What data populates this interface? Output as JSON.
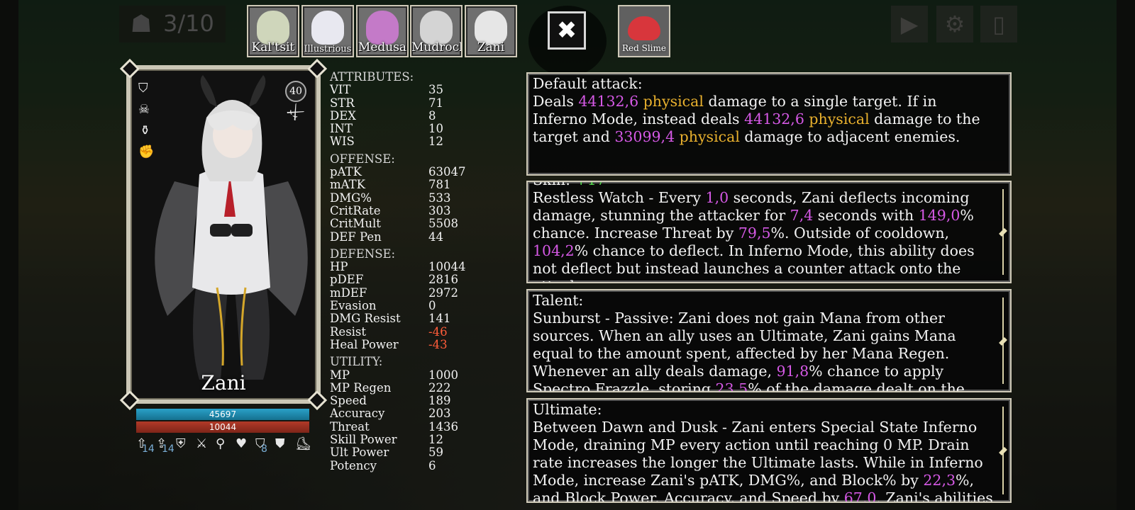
{
  "wave": {
    "counter": "3/10",
    "icon": "demon-helmet-icon"
  },
  "party": [
    {
      "name": "Kal'tsit",
      "hair": "#cfd6bb"
    },
    {
      "name": "Illustrious",
      "hair": "#e8e8f0"
    },
    {
      "name": "Medusa",
      "hair": "#c47ac8"
    },
    {
      "name": "Mudrock",
      "hair": "#d4d4d4"
    },
    {
      "name": "Zani",
      "hair": "#e6e6e6"
    }
  ],
  "close_label": "✖",
  "enemy": {
    "name": "Red Slime",
    "color": "#d8363c"
  },
  "toolbar": {
    "play": "▶",
    "settings": "⚙",
    "exit": "▯"
  },
  "character": {
    "name": "Zani",
    "level": "40",
    "mp": "45697",
    "hp": "10044",
    "buffs": [
      {
        "icon": "attack-up-icon",
        "count": "14"
      },
      {
        "icon": "speed-up-icon",
        "count": "14"
      },
      {
        "icon": "defense-up-icon",
        "count": ""
      },
      {
        "icon": "sword-icon",
        "count": ""
      },
      {
        "icon": "magnify-icon",
        "count": ""
      },
      {
        "icon": "heart-icon",
        "count": ""
      },
      {
        "icon": "shield-icon",
        "count": "8"
      },
      {
        "icon": "guard-icon",
        "count": ""
      },
      {
        "icon": "boot-icon",
        "count": ""
      }
    ]
  },
  "stats": {
    "attributes": {
      "title": "ATTRIBUTES:",
      "rows": [
        [
          "VIT",
          "35"
        ],
        [
          "STR",
          "71"
        ],
        [
          "DEX",
          "8"
        ],
        [
          "INT",
          "10"
        ],
        [
          "WIS",
          "12"
        ]
      ]
    },
    "offense": {
      "title": "OFFENSE:",
      "rows": [
        [
          "pATK",
          "63047"
        ],
        [
          "mATK",
          "781"
        ],
        [
          "DMG%",
          "533"
        ],
        [
          "CritRate",
          "303"
        ],
        [
          "CritMult",
          "5508"
        ],
        [
          "DEF Pen",
          "44"
        ]
      ]
    },
    "defense": {
      "title": "DEFENSE:",
      "rows": [
        [
          "HP",
          "10044"
        ],
        [
          "pDEF",
          "2816"
        ],
        [
          "mDEF",
          "2972"
        ],
        [
          "Evasion",
          "0"
        ],
        [
          "DMG Resist",
          "141"
        ],
        [
          "Resist",
          "-46"
        ],
        [
          "Heal Power",
          "-43"
        ]
      ]
    },
    "utility": {
      "title": "UTILITY:",
      "rows": [
        [
          "MP",
          "1000"
        ],
        [
          "MP Regen",
          "222"
        ],
        [
          "Speed",
          "189"
        ],
        [
          "Accuracy",
          "203"
        ],
        [
          "Threat",
          "1436"
        ],
        [
          "Skill Power",
          "12"
        ],
        [
          "Ult Power",
          "59"
        ],
        [
          "Potency",
          "6"
        ]
      ]
    }
  },
  "abilities": {
    "default": {
      "title": "Default attack:",
      "t1": "Deals ",
      "v1": "44132,6",
      "p1": " physical",
      "t2": " damage to a single target. If in Inferno Mode, instead deals ",
      "v2": "44132,6",
      "p2": " physical",
      "t3": " damage to the target and ",
      "v3": "33099,4",
      "p3": " physical",
      "t4": " damage to adjacent enemies."
    },
    "skill": {
      "title": "Skill: ",
      "bonus": "+17",
      "t1": "Restless Watch - Every ",
      "v1": "1,0",
      "t2": " seconds, Zani deflects incoming damage, stunning the attacker for ",
      "v2": "7,4",
      "t3": " seconds with ",
      "v3": "149,0",
      "t4": "% chance. Increase Threat by ",
      "v4": "79,5",
      "t5": "%. Outside of cooldown, ",
      "v5": "104,2",
      "t6": "% chance to deflect. In Inferno Mode, this ability does not deflect but instead launches a counter attack onto the attacker."
    },
    "talent": {
      "title": "Talent:",
      "t1": "Sunburst - Passive: Zani does not gain Mana from other sources. When an ally uses an Ultimate, Zani gains Mana equal to the amount spent, affected by her Mana Regen. Whenever an ally deals damage, ",
      "v1": "91,8",
      "t2": "% chance to apply Spectro Frazzle, storing ",
      "v2": "23,5",
      "t3": "% of the damage dealt on the enemy. When Zani damages an enemy"
    },
    "ultimate": {
      "title": "Ultimate:",
      "t1": "Between Dawn and Dusk - Zani enters Special State Inferno Mode, draining MP every action until reaching 0 MP. Drain rate increases the longer the Ultimate lasts. While in Inferno Mode, increase Zani's pATK, DMG%, and Block% by ",
      "v1": "22,3",
      "t2": "%, and Block Power, Accuracy, and Speed by ",
      "v2": "67,0",
      "t3": ". Zani's abilities change while in"
    }
  }
}
